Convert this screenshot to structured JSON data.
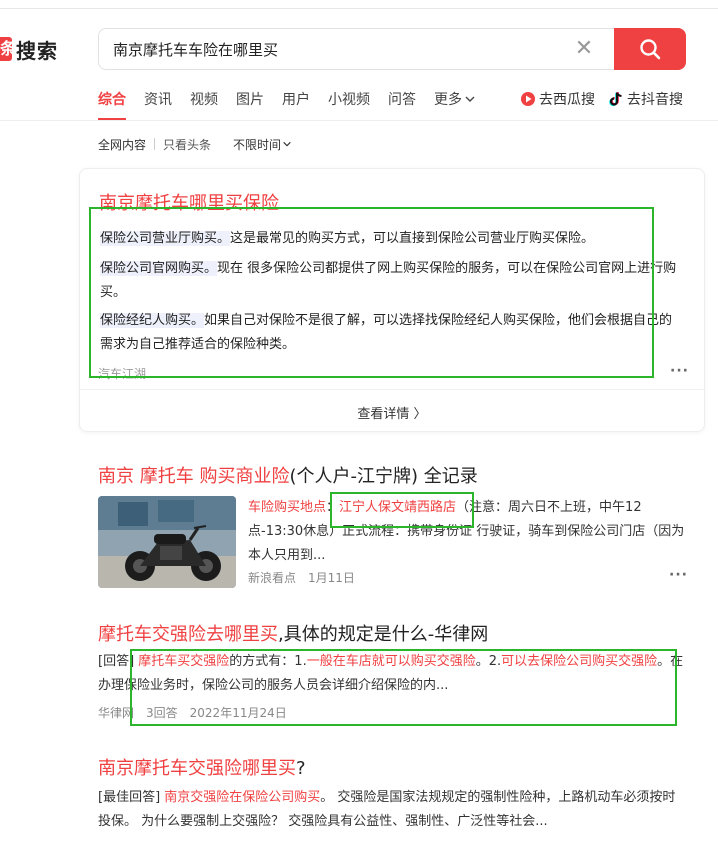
{
  "logo": {
    "mark": "条",
    "text": "搜索"
  },
  "search": {
    "query": "南京摩托车车险在哪里买"
  },
  "tabs": [
    "综合",
    "资讯",
    "视频",
    "图片",
    "用户",
    "小视频",
    "问答"
  ],
  "tabs_more": "更多",
  "external": [
    {
      "label": "去西瓜搜",
      "icon": "xigua-icon"
    },
    {
      "label": "去抖音搜",
      "icon": "douyin-icon"
    }
  ],
  "filters": {
    "scope_all": "全网内容",
    "scope_toutiao": "只看头条",
    "time": "不限时间"
  },
  "featured": {
    "title": "南京摩托车哪里买保险",
    "items": [
      {
        "term": "保险公司营业厅购买。",
        "text": "这是最常见的购买方式，可以直接到保险公司营业厅购买保险。"
      },
      {
        "term": "保险公司官网购买。",
        "text": "现在 很多保险公司都提供了网上购买保险的服务，可以在保险公司官网上进行购买。"
      },
      {
        "term": "保险经纪人购买。",
        "text": "如果自己对保险不是很了解，可以选择找保险经纪人购买保险，他们会根据自己的需求为自己推荐适合的保险种类。"
      }
    ],
    "source": "汽车江湖",
    "detail_label": "查看详情 〉"
  },
  "results": [
    {
      "title_parts": [
        {
          "text": "南京 摩托车 购买商业险",
          "red": true
        },
        {
          "text": "(个人户-江宁牌) 全记录",
          "red": false
        }
      ],
      "snippet_parts": [
        {
          "text": "车险购买地点",
          "red": true
        },
        {
          "text": "：",
          "red": false
        },
        {
          "text": "江宁人保文靖西路店",
          "red": true
        },
        {
          "text": "（注意：周六日不上班，中午12点-13:30休息）正式流程：携带身份证 行驶证，骑车到保险公司门店（因为本人只用到...",
          "red": false
        }
      ],
      "source": "新浪看点",
      "date": "1月11日"
    },
    {
      "title_parts": [
        {
          "text": "摩托车交强险去哪里买",
          "red": true
        },
        {
          "text": ",具体的规定是什么-华律网",
          "red": false
        }
      ],
      "snippet_parts": [
        {
          "text": "[回答] ",
          "red": false
        },
        {
          "text": "摩托车买交强险",
          "red": true
        },
        {
          "text": "的方式有：1.",
          "red": false
        },
        {
          "text": "一般在车店就可以购买交强险",
          "red": true
        },
        {
          "text": "。2.",
          "red": false
        },
        {
          "text": "可以去保险公司购买交强险",
          "red": true
        },
        {
          "text": "。在办理保险业务时，保险公司的服务人员会详细介绍保险的内...",
          "red": false
        }
      ],
      "source": "华律网",
      "answers": "3回答",
      "date": "2022年11月24日"
    },
    {
      "title_parts": [
        {
          "text": "南京摩托车交强险哪里买",
          "red": true
        },
        {
          "text": "?",
          "red": false
        }
      ],
      "snippet_parts": [
        {
          "text": "[最佳回答] ",
          "red": false
        },
        {
          "text": "南京交强险在保险公司购买",
          "red": true
        },
        {
          "text": "。 交强险是国家法规规定的强制性险种，上路机动车必须按时投保。 为什么要强制上交强险？ 交强险具有公益性、强制性、广泛性等社会...",
          "red": false
        }
      ]
    }
  ],
  "colors": {
    "accent": "#f04142",
    "annotation": "#2bb52b",
    "highlight": "#eef1fb"
  }
}
